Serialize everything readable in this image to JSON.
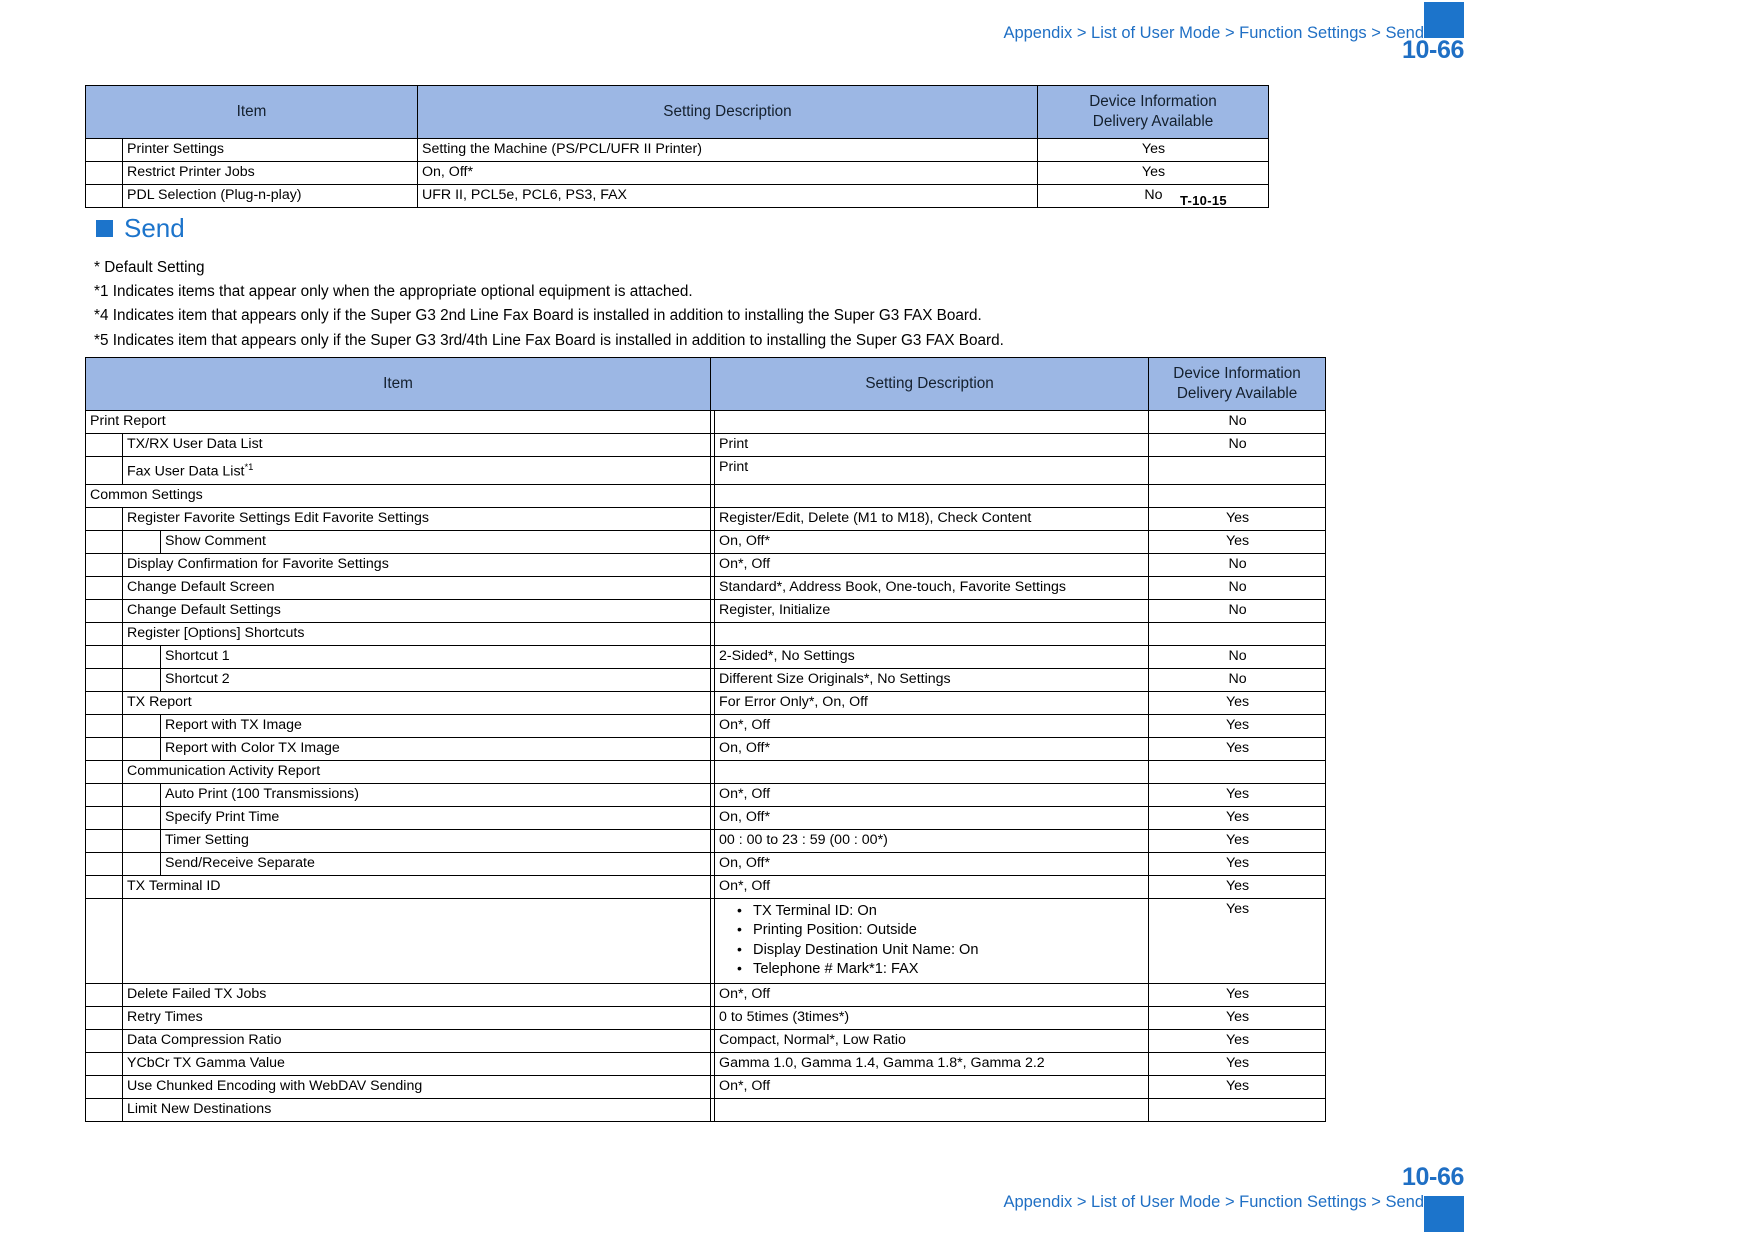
{
  "header": {
    "breadcrumb": "Appendix > List of User Mode > Function Settings > Send",
    "page_number": "10-66",
    "accent_color": "#1c74cb"
  },
  "footer": {
    "breadcrumb": "Appendix > List of User Mode > Function Settings > Send",
    "page_number": "10-66"
  },
  "section": {
    "title": "Send",
    "marker": "square-bullet-icon"
  },
  "notes": [
    "* Default Setting",
    "*1 Indicates items that appear only when the appropriate optional equipment is attached.",
    "*4 Indicates item that appears only if the Super G3 2nd Line Fax Board is installed in addition to installing the Super G3 FAX Board.",
    "*5 Indicates item that appears only if the Super G3 3rd/4th Line Fax Board is installed in addition to installing the Super G3 FAX Board."
  ],
  "table1": {
    "caption": "T-10-15",
    "headers": {
      "item": "Item",
      "setting": "Setting Description",
      "device_line1": "Device Information",
      "device_line2": "Delivery Available"
    },
    "rows": [
      {
        "indent": 1,
        "item": "Printer Settings",
        "setting": "Setting the Machine (PS/PCL/UFR II Printer)",
        "device": "Yes"
      },
      {
        "indent": 1,
        "item": "Restrict Printer Jobs",
        "setting": "On, Off*",
        "device": "Yes"
      },
      {
        "indent": 1,
        "item": "PDL Selection (Plug-n-play)",
        "setting": "UFR II, PCL5e, PCL6, PS3, FAX",
        "device": "No"
      }
    ]
  },
  "table2": {
    "headers": {
      "item": "Item",
      "setting": "Setting Description",
      "device_line1": "Device Information",
      "device_line2": "Delivery Available"
    },
    "rows": [
      {
        "indent": 0,
        "item": "Print Report",
        "setting": "",
        "device": "No"
      },
      {
        "indent": 1,
        "item": "TX/RX User Data List",
        "setting": "Print",
        "device": "No"
      },
      {
        "indent": 1,
        "item": "Fax User Data List",
        "footnote": "*1",
        "setting": "Print",
        "device": ""
      },
      {
        "indent": 0,
        "item": "Common Settings",
        "setting": "",
        "device": ""
      },
      {
        "indent": 1,
        "item": "Register Favorite Settings Edit Favorite Settings",
        "setting": "Register/Edit, Delete (M1 to M18), Check Content",
        "device": "Yes"
      },
      {
        "indent": 2,
        "item": "Show Comment",
        "setting": "On, Off*",
        "device": "Yes"
      },
      {
        "indent": 1,
        "item": "Display Confirmation for Favorite Settings",
        "setting": "On*, Off",
        "device": "No"
      },
      {
        "indent": 1,
        "item": "Change Default Screen",
        "setting": "Standard*, Address Book, One-touch, Favorite Settings",
        "device": "No"
      },
      {
        "indent": 1,
        "item": "Change Default Settings",
        "setting": "Register, Initialize",
        "device": "No"
      },
      {
        "indent": 1,
        "item": "Register [Options] Shortcuts",
        "setting": "",
        "device": ""
      },
      {
        "indent": 2,
        "item": "Shortcut 1",
        "setting": "2-Sided*, No Settings",
        "device": "No"
      },
      {
        "indent": 2,
        "item": "Shortcut 2",
        "setting": "Different Size Originals*, No Settings",
        "device": "No"
      },
      {
        "indent": 1,
        "item": "TX Report",
        "setting": "For Error Only*, On, Off",
        "device": "Yes"
      },
      {
        "indent": 2,
        "item": "Report with TX Image",
        "setting": "On*, Off",
        "device": "Yes"
      },
      {
        "indent": 2,
        "item": "Report with Color TX Image",
        "setting": "On, Off*",
        "device": "Yes"
      },
      {
        "indent": 1,
        "item": "Communication Activity Report",
        "setting": "",
        "device": ""
      },
      {
        "indent": 2,
        "item": "Auto Print (100 Transmissions)",
        "setting": "On*, Off",
        "device": "Yes"
      },
      {
        "indent": 2,
        "item": "Specify Print Time",
        "setting": "On, Off*",
        "device": "Yes"
      },
      {
        "indent": 2,
        "item": "Timer Setting",
        "setting": "00 : 00 to 23 : 59 (00 : 00*)",
        "device": "Yes"
      },
      {
        "indent": 2,
        "item": "Send/Receive Separate",
        "setting": "On, Off*",
        "device": "Yes"
      },
      {
        "indent": 1,
        "item": "TX Terminal ID",
        "setting": "On*, Off",
        "device": "Yes"
      },
      {
        "indent": 1,
        "item": "",
        "bullets": [
          "TX Terminal ID: On",
          "Printing Position: Outside",
          "Display Destination Unit Name: On",
          "Telephone # Mark*1: FAX"
        ],
        "device": "Yes"
      },
      {
        "indent": 1,
        "item": "Delete Failed TX Jobs",
        "setting": "On*, Off",
        "device": "Yes"
      },
      {
        "indent": 1,
        "item": "Retry Times",
        "setting": "0 to 5times (3times*)",
        "device": "Yes"
      },
      {
        "indent": 1,
        "item": "Data Compression Ratio",
        "setting": "Compact, Normal*, Low Ratio",
        "device": "Yes"
      },
      {
        "indent": 1,
        "item": "YCbCr TX Gamma Value",
        "setting": "Gamma 1.0, Gamma 1.4, Gamma 1.8*, Gamma 2.2",
        "device": "Yes"
      },
      {
        "indent": 1,
        "item": "Use Chunked Encoding with WebDAV Sending",
        "setting": "On*, Off",
        "device": "Yes"
      },
      {
        "indent": 1,
        "item": "Limit New Destinations",
        "setting": "",
        "device": ""
      }
    ]
  }
}
